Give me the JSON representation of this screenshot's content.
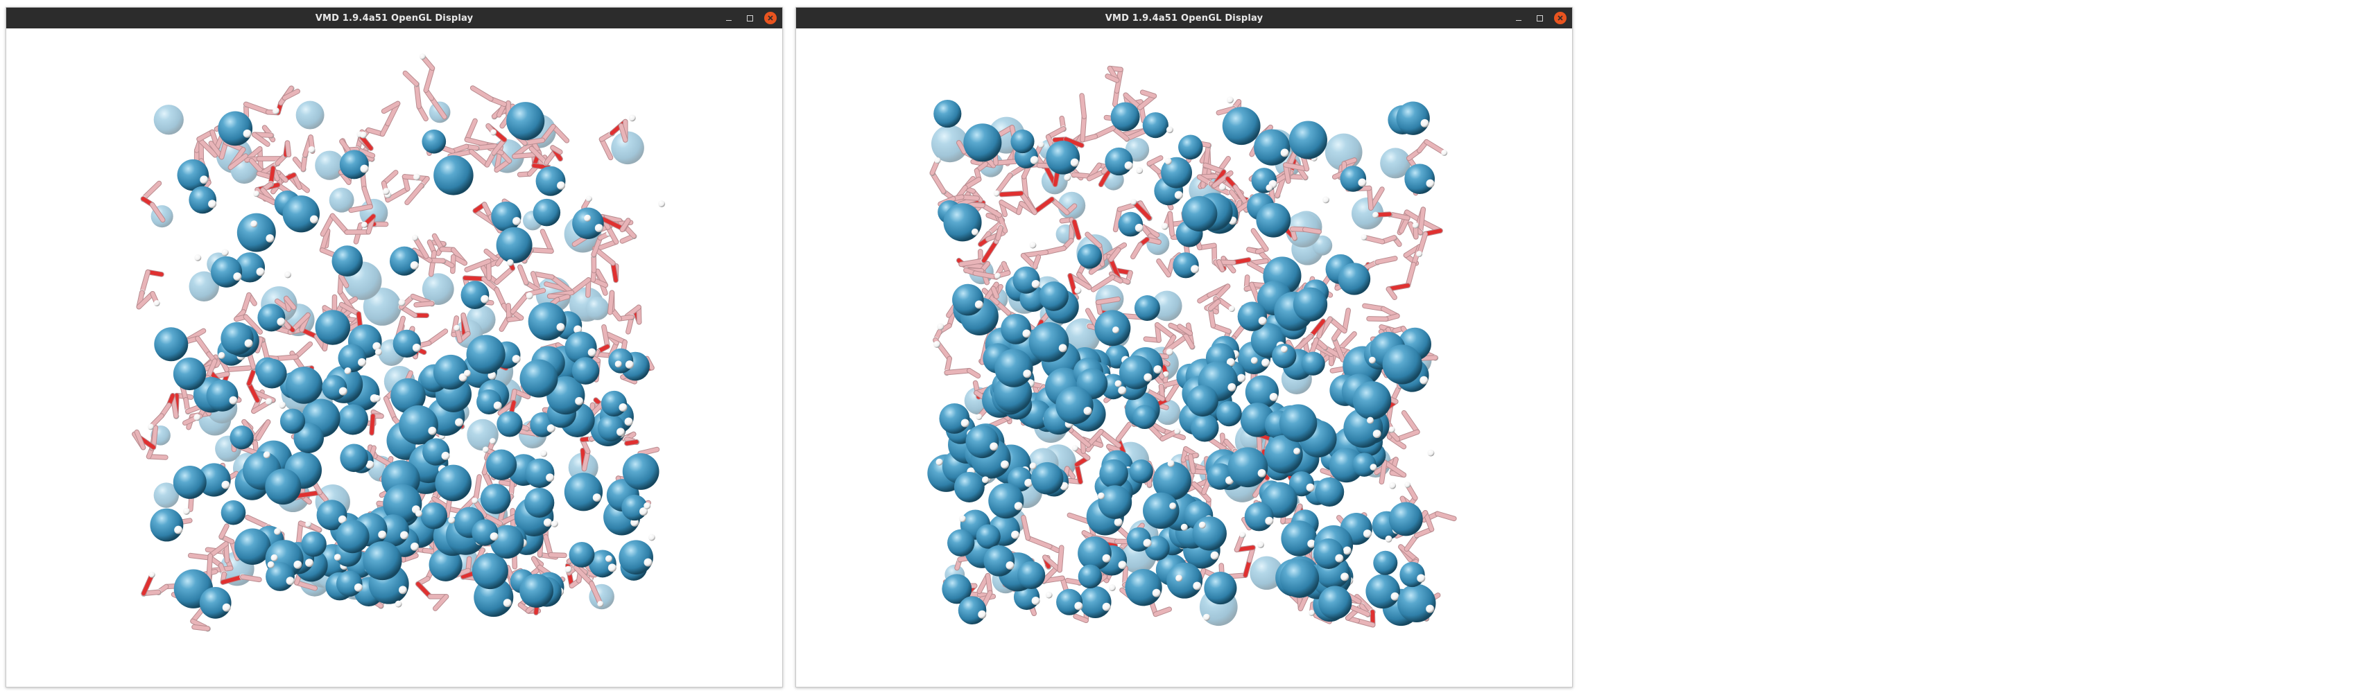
{
  "windows": [
    {
      "title": "VMD 1.9.4a51 OpenGL Display",
      "controls": {
        "minimize": "minimize-icon",
        "maximize": "maximize-icon",
        "close": "close-icon"
      },
      "scene": "molecular-structure-render"
    },
    {
      "title": "VMD 1.9.4a51 OpenGL Display",
      "controls": {
        "minimize": "minimize-icon",
        "maximize": "maximize-icon",
        "close": "close-icon"
      },
      "scene": "molecular-structure-render"
    }
  ],
  "colors": {
    "titlebar": "#2c2c2c",
    "close_button": "#e9541f",
    "sphere_blue": "#2f7fa8",
    "stick_pink": "#e8b4b8",
    "oxygen_red": "#e03030",
    "hydrogen_white": "#f2f2f2"
  }
}
